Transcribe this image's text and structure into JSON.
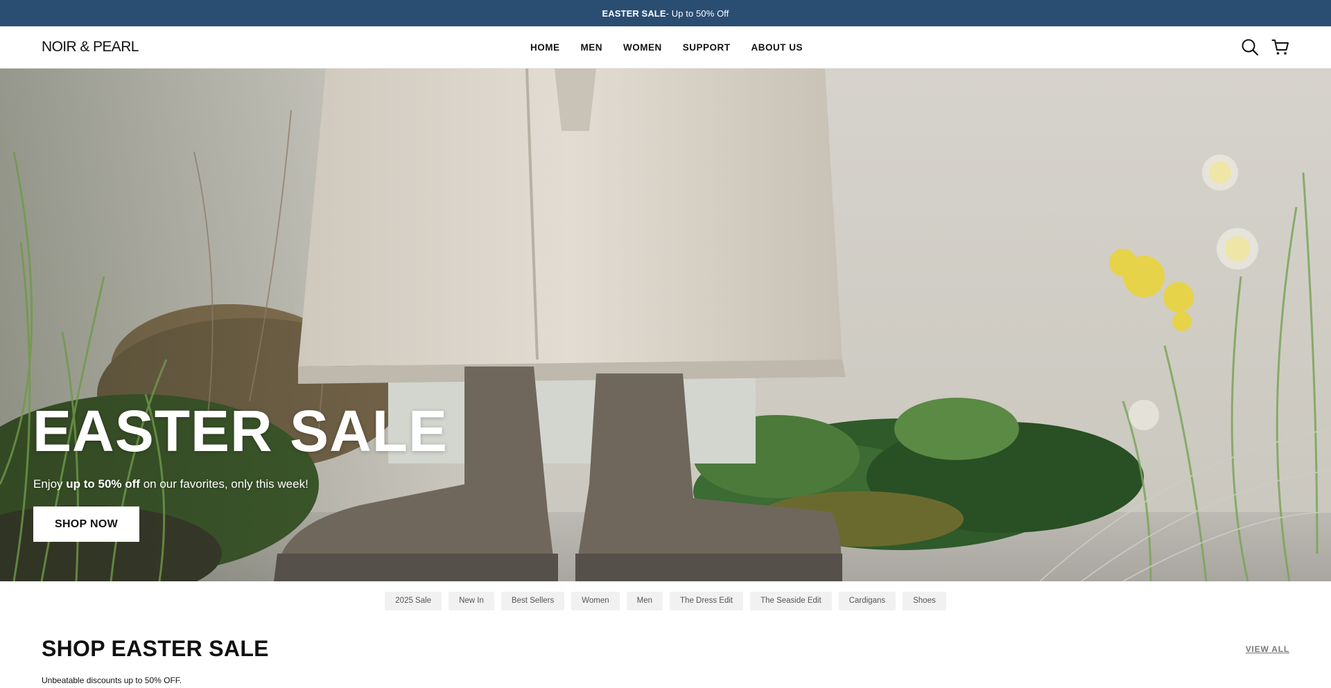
{
  "announcement": {
    "bold": "EASTER SALE",
    "text": " - Up to 50% Off"
  },
  "header": {
    "logo": "NOIR & PEARL",
    "nav": [
      "HOME",
      "MEN",
      "WOMEN",
      "SUPPORT",
      "ABOUT US"
    ],
    "icons": [
      "search-icon",
      "cart-icon"
    ]
  },
  "hero": {
    "title": "EASTER SALE",
    "sub_pre": "Enjoy ",
    "sub_bold": "up to 50% off",
    "sub_post": " on our favorites, only this week!",
    "button": "SHOP NOW"
  },
  "chips": [
    "2025 Sale",
    "New In",
    "Best Sellers",
    "Women",
    "Men",
    "The Dress Edit",
    "The Seaside Edit",
    "Cardigans",
    "Shoes"
  ],
  "section": {
    "title": "SHOP EASTER SALE",
    "view_all": "VIEW ALL",
    "subtitle": "Unbeatable discounts up to 50% OFF."
  },
  "colors": {
    "announce_bg": "#2a4d72",
    "chip_bg": "#f1f1f1"
  }
}
